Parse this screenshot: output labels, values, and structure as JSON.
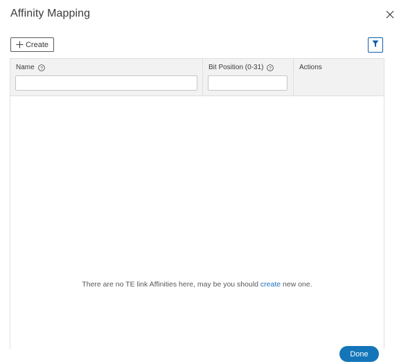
{
  "dialog": {
    "title": "Affinity Mapping"
  },
  "toolbar": {
    "create_label": "Create",
    "icons": {
      "create": "plus-icon",
      "filter": "filter-icon",
      "close": "close-icon"
    },
    "accent_color": "#0d5cab"
  },
  "table": {
    "columns": [
      {
        "label": "Name",
        "has_help": true,
        "has_filter_input": true,
        "filter_value": ""
      },
      {
        "label": "Bit Position (0-31)",
        "has_help": true,
        "has_filter_input": true,
        "filter_value": ""
      },
      {
        "label": "Actions",
        "has_help": false,
        "has_filter_input": false
      }
    ],
    "rows": [],
    "empty_message": {
      "before": "There are no TE link Affinities here, may be you should ",
      "link": "create",
      "after": " new one."
    }
  },
  "footer": {
    "done_label": "Done",
    "done_color": "#1475b9"
  }
}
